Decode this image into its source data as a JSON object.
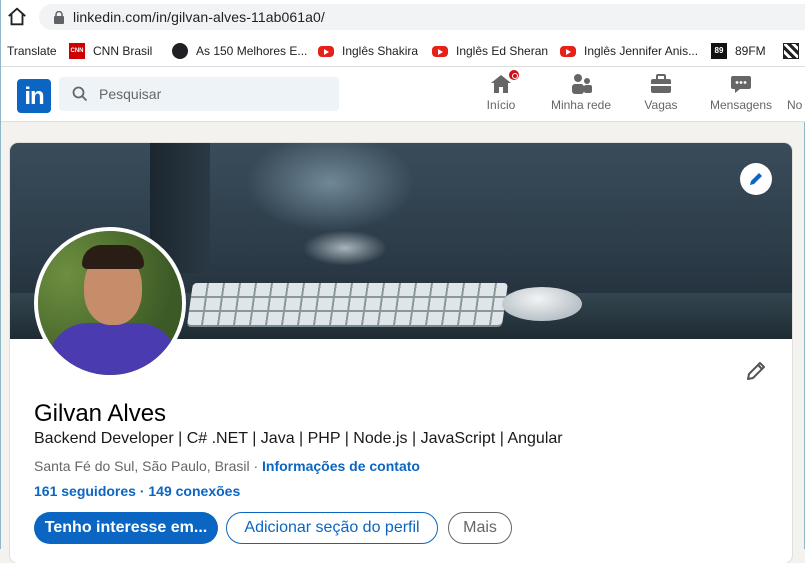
{
  "browser": {
    "url": "linkedin.com/in/gilvan-alves-11ab061a0/",
    "bookmarks": [
      {
        "label": "Translate",
        "icon": "none"
      },
      {
        "label": "CNN Brasil",
        "icon": "cnn-icon"
      },
      {
        "label": "As 150 Melhores E...",
        "icon": "globe-icon"
      },
      {
        "label": "Inglês Shakira",
        "icon": "youtube-icon"
      },
      {
        "label": "Inglês Ed Sheran",
        "icon": "youtube-icon"
      },
      {
        "label": "Inglês Jennifer Anis...",
        "icon": "youtube-icon"
      },
      {
        "label": "89FM",
        "icon": "radio-icon"
      }
    ]
  },
  "nav": {
    "logo": "in",
    "search_placeholder": "Pesquisar",
    "items": [
      {
        "label": "Início",
        "icon": "home-icon",
        "has_badge": true
      },
      {
        "label": "Minha rede",
        "icon": "network-icon"
      },
      {
        "label": "Vagas",
        "icon": "briefcase-icon"
      },
      {
        "label": "Mensagens",
        "icon": "messaging-icon"
      },
      {
        "label": "No",
        "icon": "notifications-icon"
      }
    ]
  },
  "profile": {
    "name": "Gilvan Alves",
    "headline": "Backend Developer | C# .NET | Java | PHP | Node.js | JavaScript | Angular",
    "location": "Santa Fé do Sul, São Paulo, Brasil",
    "location_separator": " · ",
    "contact_link": "Informações de contato",
    "followers": "161 seguidores",
    "stats_separator": " · ",
    "connections": "149 conexões",
    "buttons": {
      "primary": "Tenho interesse em...",
      "add_section": "Adicionar seção do perfil",
      "more": "Mais"
    }
  },
  "colors": {
    "brand": "#0a66c2",
    "badge": "#cc1016",
    "page_bg": "#f3f2ef"
  }
}
